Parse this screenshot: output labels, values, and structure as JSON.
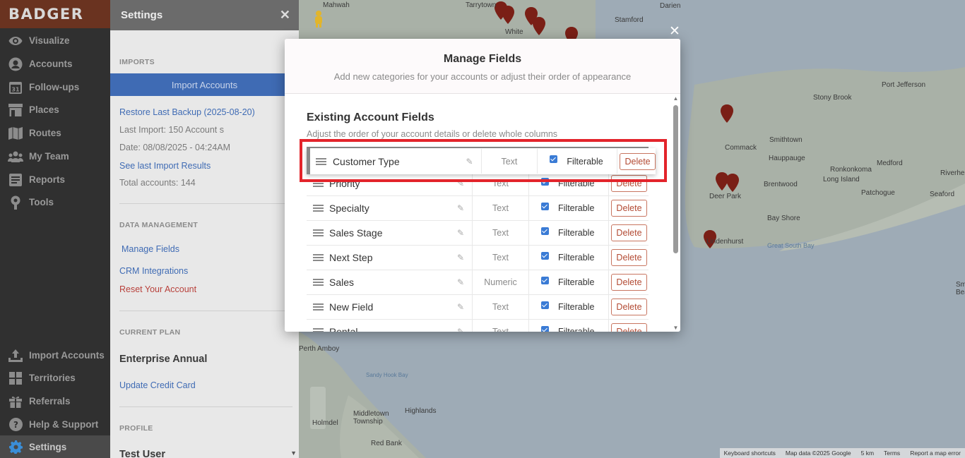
{
  "nav": {
    "logo": "BADGER",
    "items": [
      {
        "label": "Visualize",
        "icon": "eye-icon"
      },
      {
        "label": "Accounts",
        "icon": "person-icon"
      },
      {
        "label": "Follow-ups",
        "icon": "calendar-icon",
        "badge": "31"
      },
      {
        "label": "Places",
        "icon": "store-icon"
      },
      {
        "label": "Routes",
        "icon": "map-icon"
      },
      {
        "label": "My Team",
        "icon": "team-icon"
      },
      {
        "label": "Reports",
        "icon": "report-icon"
      },
      {
        "label": "Tools",
        "icon": "tools-icon"
      }
    ],
    "bottom_items": [
      {
        "label": "Import Accounts",
        "icon": "upload-icon"
      },
      {
        "label": "Territories",
        "icon": "territory-icon"
      },
      {
        "label": "Referrals",
        "icon": "gift-icon"
      },
      {
        "label": "Help & Support",
        "icon": "help-icon"
      },
      {
        "label": "Settings",
        "icon": "gear-icon",
        "active": true
      }
    ]
  },
  "settings": {
    "title": "Settings",
    "imports_header": "IMPORTS",
    "import_button": "Import Accounts",
    "restore_link": "Restore Last Backup (2025-08-20)",
    "last_import": "Last Import: 150 Account s",
    "date": "Date: 08/08/2025 - 04:24AM",
    "see_results_link": "See last Import Results",
    "total_accounts": "Total accounts: 144",
    "data_header": "DATA MANAGEMENT",
    "manage_fields_link": "Manage Fields",
    "crm_link": "CRM Integrations",
    "reset_link": "Reset Your Account",
    "plan_header": "CURRENT PLAN",
    "plan_name": "Enterprise Annual",
    "update_card_link": "Update Credit Card",
    "profile_header": "PROFILE",
    "user_name": "Test User"
  },
  "map": {
    "labels": [
      "Mahwah",
      "Tarrytown",
      "White",
      "Stamford",
      "Darien",
      "Port Jefferson",
      "Stony Brook",
      "Smithtown",
      "Commack",
      "Hauppauge",
      "Ronkonkoma",
      "Medford",
      "Riverhead",
      "Seaford",
      "Brentwood",
      "Long Island",
      "Patchogue",
      "Deer Park",
      "Bay Shore",
      "Lindenhurst",
      "Great South Bay",
      "Sandy Hook Bay",
      "Middletown Township",
      "Highlands",
      "Red Bank",
      "Holmdel",
      "Perth Amboy",
      "Smith Beach"
    ],
    "attribution": [
      "Keyboard shortcuts",
      "Map data ©2025 Google",
      "5 km",
      "Terms",
      "Report a map error"
    ]
  },
  "modal": {
    "title": "Manage Fields",
    "subtitle": "Add new categories for your accounts or adjust their order of appearance",
    "section_title": "Existing Account Fields",
    "section_sub": "Adjust the order of your account details or delete whole columns",
    "filterable_label": "Filterable",
    "delete_label": "Delete",
    "dragging_field": {
      "name": "Customer Type",
      "type": "Text"
    },
    "fields": [
      {
        "name": "Priority",
        "type": "Text"
      },
      {
        "name": "Specialty",
        "type": "Text"
      },
      {
        "name": "Sales Stage",
        "type": "Text"
      },
      {
        "name": "Next Step",
        "type": "Text"
      },
      {
        "name": "Sales",
        "type": "Numeric"
      },
      {
        "name": "New Field",
        "type": "Text"
      },
      {
        "name": "Rental",
        "type": "Text"
      }
    ]
  },
  "colors": {
    "nav_bg": "#303030",
    "logo_bg": "#6a3320",
    "accent_blue": "#3f6bb4",
    "delete_red": "#b34a33",
    "highlight": "#e3242b"
  }
}
